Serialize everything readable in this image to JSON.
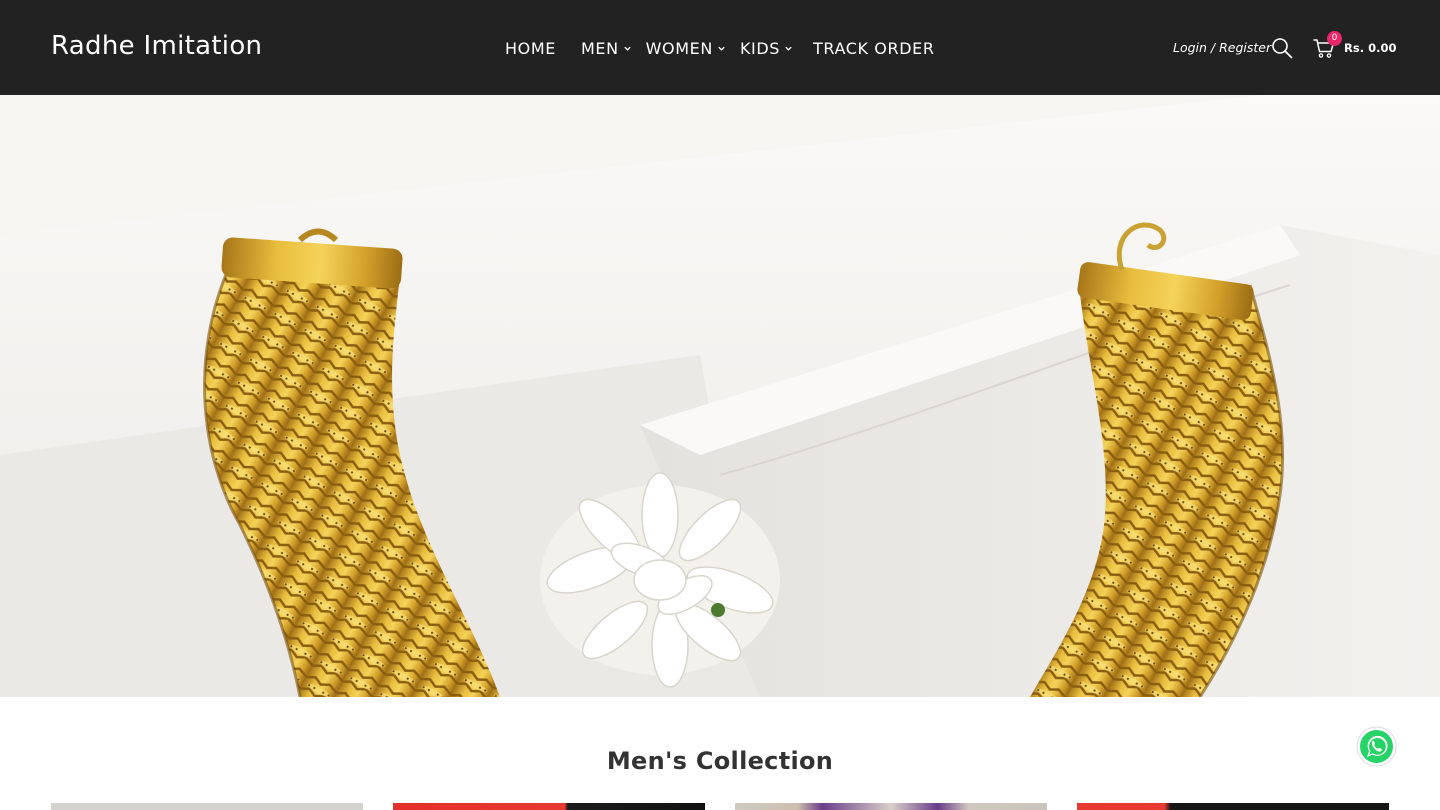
{
  "header": {
    "logo": "Radhe Imitation",
    "nav": {
      "home": "HOME",
      "men": "MEN",
      "women": "WOMEN",
      "kids": "KIDS",
      "track_order": "TRACK ORDER"
    },
    "login": "Login / Register",
    "cart_count": "0",
    "cart_total": "Rs. 0.00"
  },
  "icons": {
    "search": "search-icon",
    "cart": "cart-icon",
    "chevron": "chevron-down-icon",
    "whatsapp": "whatsapp-icon"
  },
  "colors": {
    "header_bg": "#222222",
    "badge": "#e8276b",
    "whatsapp": "#25d366",
    "gold": "#d9a82a"
  },
  "main": {
    "section_title": "Men's Collection"
  }
}
